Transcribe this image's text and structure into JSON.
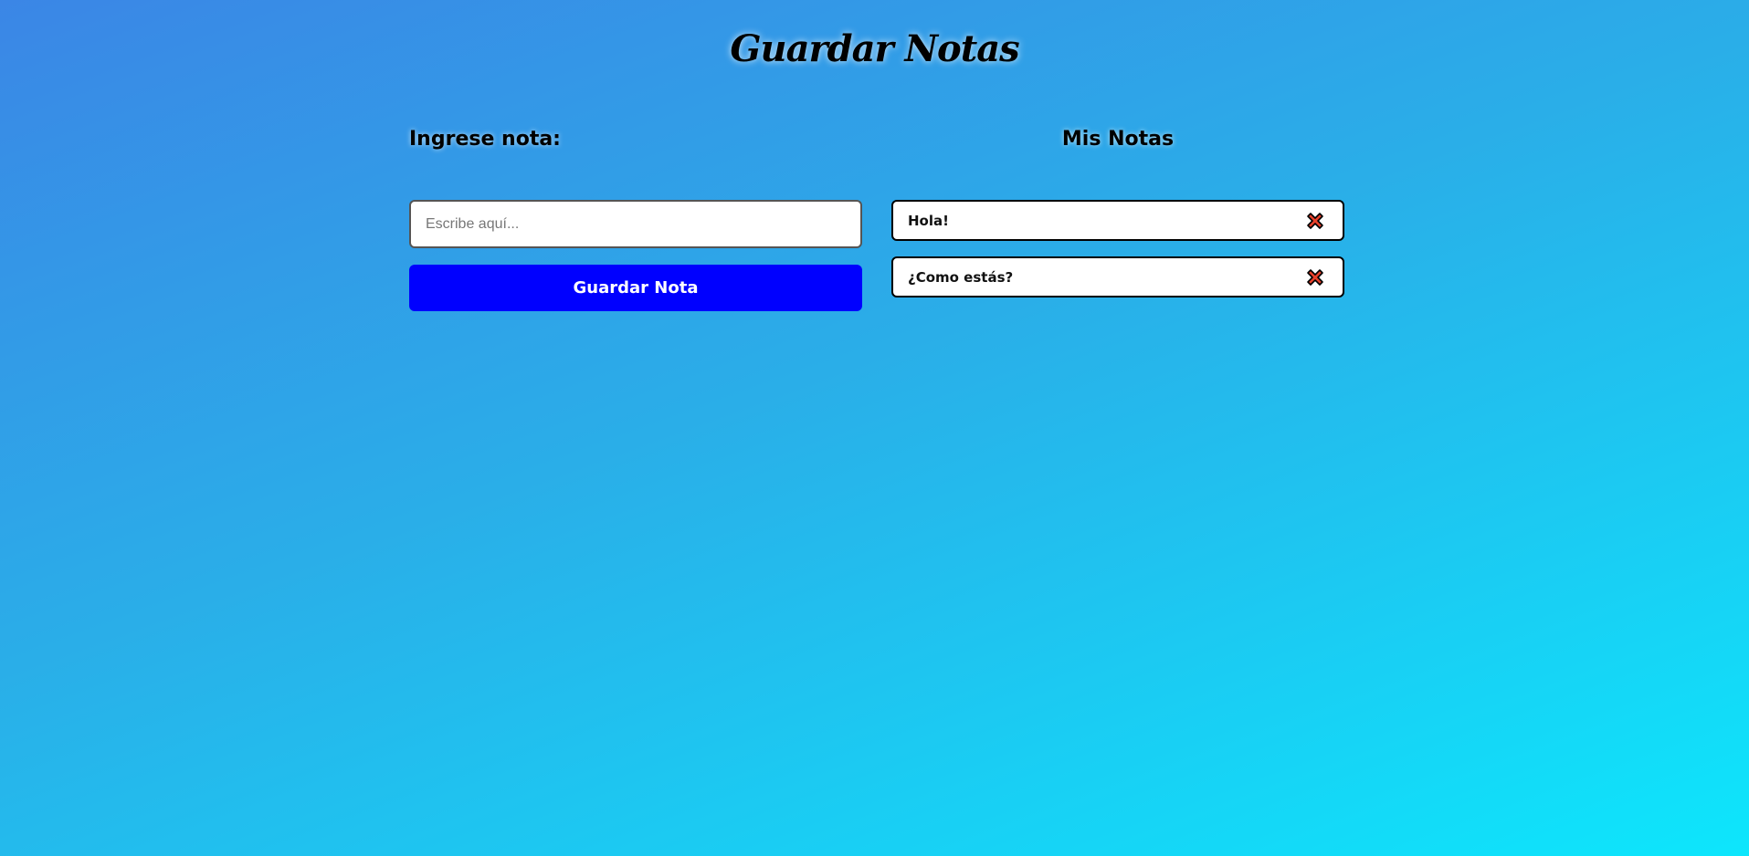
{
  "app": {
    "title": "Guardar Notas"
  },
  "form": {
    "heading": "Ingrese nota:",
    "input_placeholder": "Escribe aquí...",
    "input_value": "",
    "save_label": "Guardar Nota"
  },
  "notes": {
    "heading": "Mis Notas",
    "items": [
      {
        "text": "Hola!",
        "delete_icon": "close-icon"
      },
      {
        "text": "¿Como estás?",
        "delete_icon": "close-icon"
      }
    ]
  },
  "colors": {
    "save_button": "#0000ff",
    "delete_icon_fill": "#e8402a",
    "background_start": "#3b86e6",
    "background_end": "#0de6fc"
  }
}
